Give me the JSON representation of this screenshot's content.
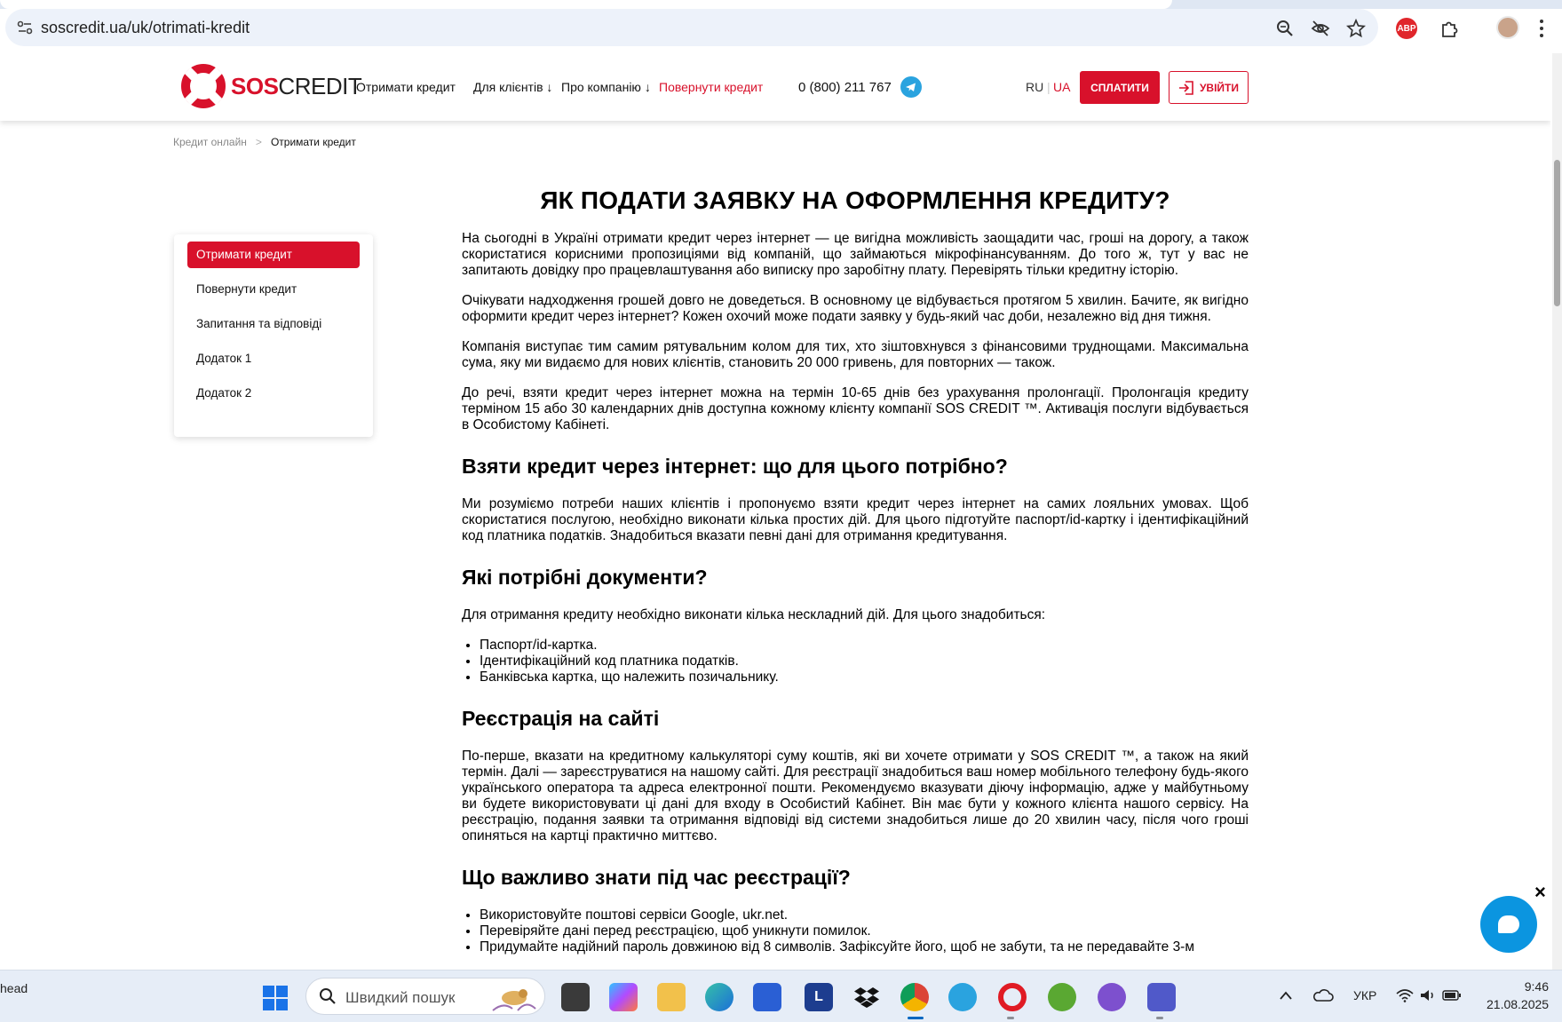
{
  "browser": {
    "url": "soscredit.ua/uk/otrimati-kredit",
    "extension_abp_label": "ABP",
    "icons": [
      "site-info-icon",
      "zoom-icon",
      "eye-slash-icon",
      "star-icon",
      "abp-icon",
      "puzzle-icon",
      "profile-avatar",
      "kebab-menu-icon"
    ]
  },
  "header": {
    "logo_sos": "SOS",
    "logo_credit": "CREDIT",
    "nav": {
      "get_credit": "Отримати кредит",
      "for_clients": "Для клієнтів ↓",
      "about": "Про компанію ↓",
      "repay": "Повернути кредит"
    },
    "phone": "0 (800) 211 767",
    "lang_ru": "RU",
    "lang_sep": "|",
    "lang_ua": "UA",
    "pay_button": "СПЛАТИТИ",
    "login_button": "УВІЙТИ"
  },
  "breadcrumb": {
    "home": "Кредит онлайн",
    "separator": ">",
    "current": "Отримати кредит"
  },
  "side_menu": [
    {
      "label": "Отримати кредит",
      "active": true
    },
    {
      "label": "Повернути кредит",
      "active": false
    },
    {
      "label": "Запитання та відповіді",
      "active": false
    },
    {
      "label": "Додаток 1",
      "active": false
    },
    {
      "label": "Додаток 2",
      "active": false
    }
  ],
  "article": {
    "title": "ЯК ПОДАТИ ЗАЯВКУ НА ОФОРМЛЕННЯ КРЕДИТУ?",
    "p1": "На сьогодні в Україні отримати кредит через інтернет — це вигідна можливість заощадити час, гроші на дорогу, а також скористатися корисними пропозиціями від компаній, що займаються мікрофінансуванням. До того ж, тут у вас не запитають довідку про працевлаштування або виписку про заробітну плату. Перевірять тільки кредитну історію.",
    "p2": "Очікувати надходження грошей довго не доведеться. В основному це відбувається протягом 5 хвилин. Бачите, як вигідно оформити кредит через інтернет? Кожен охочий може подати заявку у будь-який час доби, незалежно від дня тижня.",
    "p3": "Компанія виступає тим самим рятувальним колом для тих, хто зіштовхнувся з фінансовими труднощами. Максимальна сума, яку ми видаємо для нових клієнтів, становить 20 000 гривень, для повторних — також.",
    "p4": "До речі, взяти кредит через інтернет можна на термін 10-65 днів без урахування пролонгації. Пролонгація кредиту терміном 15 або 30 календарних днів доступна кожному клієнту компанії SOS CREDIT ™. Активація послуги відбувається в Особистому Кабінеті.",
    "h2_1": "Взяти кредит через інтернет: що для цього потрібно?",
    "p5": "Ми розуміємо потреби наших клієнтів і пропонуємо взяти кредит через інтернет на самих лояльних умовах. Щоб скористатися послугою, необхідно виконати кілька простих дій. Для цього підготуйте паспорт/id-картку і ідентифікаційний код платника податків. Знадобиться вказати певні дані для отримання кредитування.",
    "h2_2": "Які потрібні документи?",
    "p6": "Для отримання кредиту необхідно виконати кілька нескладний дій. Для цього знадобиться:",
    "docs": [
      "Паспорт/id-картка.",
      "Ідентифікаційний код платника податків.",
      "Банківська картка, що належить позичальнику."
    ],
    "h2_3": "Реєстрація на сайті",
    "p7": "По-перше, вказати на кредитному калькуляторі суму коштів, які ви хочете отримати у SOS CREDIT ™, а також на який термін. Далі — зареєструватися на нашому сайті. Для реєстрації знадобиться ваш номер мобільного телефону будь-якого українського оператора та адреса електронної пошти. Рекомендуємо вказувати діючу інформацію, адже у майбутньому ви будете використовувати ці дані для входу в Особистий Кабінет. Він має бути у кожного клієнта нашого сервісу. На реєстрацію, подання заявки та отримання відповіді від системи знадобиться лише до 20 хвилин часу, після чого гроші опиняться на картці практично миттєво.",
    "h2_4": "Що важливо знати під час реєстрації?",
    "tips": [
      "Використовуйте поштові сервіси Google, ukr.net.",
      "Перевіряйте дані перед реєстрацією, щоб уникнути помилок.",
      "Придумайте надійний пароль довжиною від 8 символів. Зафіксуйте його, щоб не забути, та не передавайте 3-м"
    ]
  },
  "chat": {
    "close_label": "×"
  },
  "taskbar": {
    "left_text": "head",
    "search_placeholder": "Швидкий пошук",
    "apps": [
      "task-view",
      "copilot",
      "file-explorer",
      "edge",
      "store",
      "l-app",
      "dropbox",
      "chrome",
      "telegram",
      "opera",
      "utorrent",
      "viber",
      "teams"
    ],
    "l_app_label": "L",
    "lang": "УКР",
    "time": "9:46",
    "date": "21.08.2025"
  },
  "colors": {
    "brand_red": "#d8112b",
    "chat_blue": "#0b95e0",
    "telegram_blue": "#2aa3df"
  }
}
